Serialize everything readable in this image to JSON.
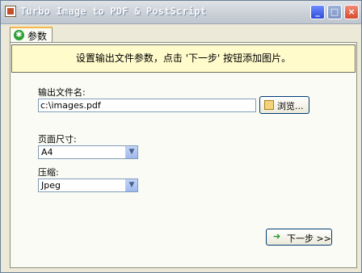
{
  "window": {
    "title": "Turbo Image to PDF & PostScript",
    "buttons": {
      "minimize": "_",
      "maximize": "□",
      "close": "×"
    }
  },
  "tabs": [
    {
      "label": "参数",
      "icon": "gear-icon"
    }
  ],
  "instruction": "设置输出文件参数，点击 '下一步' 按钮添加图片。",
  "output_file": {
    "label": "输出文件名:",
    "value": "c:\\images.pdf",
    "browse_button": "浏览..."
  },
  "page_size": {
    "label": "页面尺寸:",
    "selected": "A4"
  },
  "compression": {
    "label": "压缩:",
    "selected": "Jpeg"
  },
  "next_button": "下一步 >>"
}
